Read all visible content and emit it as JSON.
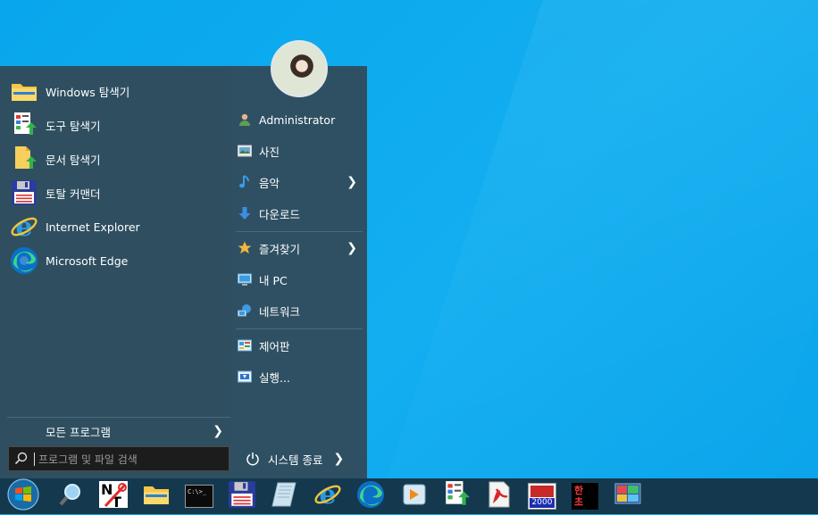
{
  "pinned": [
    {
      "label": "Windows 탐색기",
      "icon": "folder-icon"
    },
    {
      "label": "도구 탐색기",
      "icon": "tool-explorer-icon"
    },
    {
      "label": "문서 탐색기",
      "icon": "document-explorer-icon"
    },
    {
      "label": "토탈 커맨더",
      "icon": "floppy-icon"
    },
    {
      "label": "Internet Explorer",
      "icon": "internet-explorer-icon"
    },
    {
      "label": "Microsoft Edge",
      "icon": "edge-icon"
    }
  ],
  "all_programs": {
    "label": "모든 프로그램"
  },
  "search": {
    "placeholder": "프로그램 및 파일 검색"
  },
  "right_menu": [
    {
      "label": "Administrator",
      "icon": "user-icon"
    },
    {
      "label": "사진",
      "icon": "pictures-icon"
    },
    {
      "label": "음악",
      "icon": "music-icon",
      "has_submenu": true
    },
    {
      "label": "다운로드",
      "icon": "download-icon"
    },
    {
      "label": "즐겨찾기",
      "icon": "favorites-star-icon",
      "has_submenu": true
    },
    {
      "label": "내 PC",
      "icon": "computer-icon"
    },
    {
      "label": "네트워크",
      "icon": "network-icon"
    },
    {
      "label": "제어판",
      "icon": "control-panel-icon"
    },
    {
      "label": "실행...",
      "icon": "run-icon"
    }
  ],
  "shutdown": {
    "label": "시스템 종료"
  },
  "taskbar": {
    "icons": [
      "start-orb-icon",
      "search-magnifier-icon",
      "notepad-tool-icon",
      "folder-icon",
      "command-prompt-icon",
      "floppy-icon",
      "notes-icon",
      "internet-explorer-icon",
      "edge-icon",
      "media-player-icon",
      "tool-explorer-icon",
      "pdf-icon",
      "app-2000-icon",
      "hangul-icon",
      "system-monitor-icon"
    ],
    "cmd_text": "C:\\>_",
    "app_2000_text": "2000",
    "hangul_text": "한 초"
  },
  "colors": {
    "accent": "#08a6ec",
    "menu_bg": "#2f4f60",
    "taskbar_bg": "#14394f"
  }
}
